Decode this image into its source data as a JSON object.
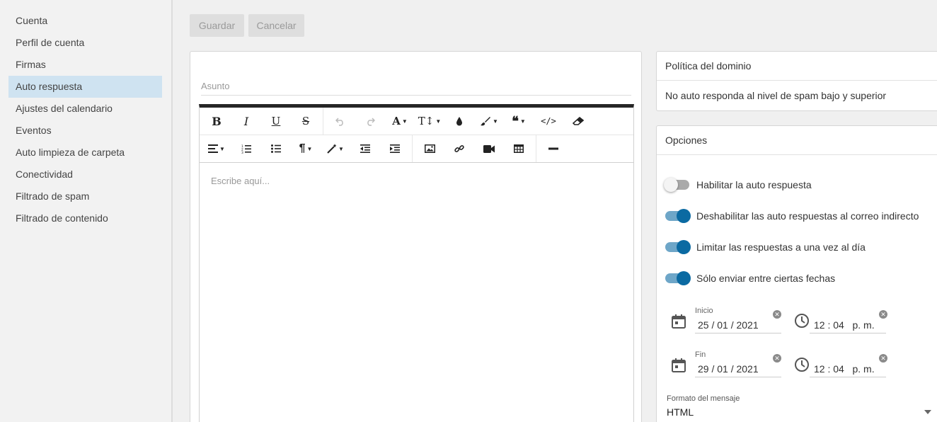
{
  "sidebar": {
    "items": [
      {
        "label": "Cuenta"
      },
      {
        "label": "Perfil de cuenta"
      },
      {
        "label": "Firmas"
      },
      {
        "label": "Auto respuesta"
      },
      {
        "label": "Ajustes del calendario"
      },
      {
        "label": "Eventos"
      },
      {
        "label": "Auto limpieza de carpeta"
      },
      {
        "label": "Conectividad"
      },
      {
        "label": "Filtrado de spam"
      },
      {
        "label": "Filtrado de contenido"
      }
    ],
    "active_index": 3,
    "active_color": "#cfe3f1"
  },
  "toolbar": {
    "save_label": "Guardar",
    "cancel_label": "Cancelar"
  },
  "editor": {
    "subject_placeholder": "Asunto",
    "body_placeholder": "Escribe aquí...",
    "toolbar_row1_icons": [
      "bold-icon",
      "italic-icon",
      "underline-icon",
      "strikethrough-icon",
      "undo-icon",
      "redo-icon",
      "font-family-icon",
      "font-size-icon",
      "color-icon",
      "brush-icon",
      "quote-icon",
      "code-view-icon",
      "eraser-icon"
    ],
    "toolbar_row2_icons": [
      "align-icon",
      "ordered-list-icon",
      "unordered-list-icon",
      "paragraph-icon",
      "magic-wand-icon",
      "outdent-icon",
      "indent-icon",
      "image-icon",
      "link-icon",
      "video-icon",
      "table-icon",
      "horizontal-rule-icon"
    ]
  },
  "policy": {
    "title": "Política del dominio",
    "text": "No auto responda al nivel de spam bajo y superior"
  },
  "options": {
    "title": "Opciones",
    "toggles": [
      {
        "label": "Habilitar la auto respuesta",
        "on": false
      },
      {
        "label": "Deshabilitar las auto respuestas al correo indirecto",
        "on": true
      },
      {
        "label": "Limitar las respuestas a una vez al día",
        "on": true
      },
      {
        "label": "Sólo enviar entre ciertas fechas",
        "on": true
      }
    ],
    "start": {
      "label": "Inicio",
      "date": "25 / 01 / 2021",
      "time": "12 : 04   p. m."
    },
    "end": {
      "label": "Fin",
      "date": "29 / 01 / 2021",
      "time": "12 : 04   p. m."
    },
    "format_label": "Formato del mensaje",
    "format_value": "HTML",
    "accent_color": "#0b6aa2"
  }
}
